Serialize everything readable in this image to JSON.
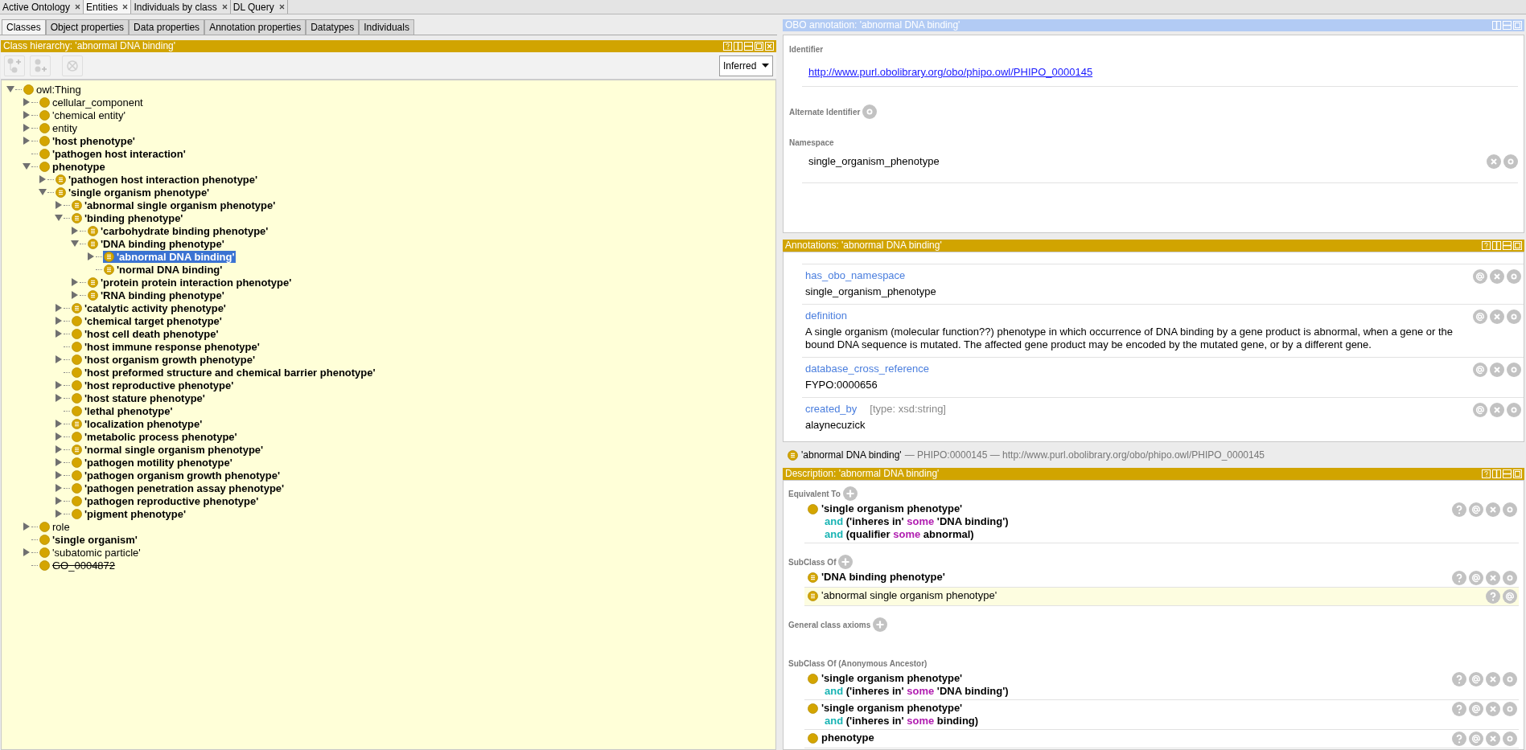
{
  "tabs": [
    {
      "label": "Active Ontology",
      "selected": false
    },
    {
      "label": "Entities",
      "selected": true
    },
    {
      "label": "Individuals by class",
      "selected": false
    },
    {
      "label": "DL Query",
      "selected": false
    }
  ],
  "entity_tabs": [
    {
      "label": "Classes",
      "selected": true
    },
    {
      "label": "Object properties",
      "selected": false
    },
    {
      "label": "Data properties",
      "selected": false
    },
    {
      "label": "Annotation properties",
      "selected": false
    },
    {
      "label": "Datatypes",
      "selected": false
    },
    {
      "label": "Individuals",
      "selected": false
    }
  ],
  "class_hierarchy": {
    "title": "Class hierarchy: 'abnormal DNA binding'",
    "mode": "Inferred",
    "tree": [
      {
        "label": "owl:Thing",
        "expanded": true,
        "bold": false,
        "defined": false,
        "selected": false,
        "deprecated": false,
        "children": [
          {
            "label": "cellular_component",
            "expanded": false,
            "bold": false,
            "defined": false,
            "selected": false,
            "deprecated": false
          },
          {
            "label": "'chemical entity'",
            "expanded": false,
            "bold": false,
            "defined": false,
            "selected": false,
            "deprecated": false
          },
          {
            "label": "entity",
            "expanded": false,
            "bold": false,
            "defined": false,
            "selected": false,
            "deprecated": false
          },
          {
            "label": "'host phenotype'",
            "expanded": false,
            "bold": true,
            "defined": false,
            "selected": false,
            "deprecated": false
          },
          {
            "label": "'pathogen host interaction'",
            "bold": true,
            "defined": false,
            "selected": false,
            "deprecated": false
          },
          {
            "label": "phenotype",
            "expanded": true,
            "bold": true,
            "defined": false,
            "selected": false,
            "deprecated": false,
            "children": [
              {
                "label": "'pathogen host interaction phenotype'",
                "expanded": false,
                "bold": true,
                "defined": true,
                "selected": false,
                "deprecated": false
              },
              {
                "label": "'single organism phenotype'",
                "expanded": true,
                "bold": true,
                "defined": true,
                "selected": false,
                "deprecated": false,
                "children": [
                  {
                    "label": "'abnormal single organism phenotype'",
                    "expanded": false,
                    "bold": true,
                    "defined": true,
                    "selected": false,
                    "deprecated": false
                  },
                  {
                    "label": "'binding phenotype'",
                    "expanded": true,
                    "bold": true,
                    "defined": true,
                    "selected": false,
                    "deprecated": false,
                    "children": [
                      {
                        "label": "'carbohydrate binding phenotype'",
                        "expanded": false,
                        "bold": true,
                        "defined": true,
                        "selected": false,
                        "deprecated": false
                      },
                      {
                        "label": "'DNA binding phenotype'",
                        "expanded": true,
                        "bold": true,
                        "defined": true,
                        "selected": false,
                        "deprecated": false,
                        "children": [
                          {
                            "label": "'abnormal DNA binding'",
                            "expanded": false,
                            "bold": true,
                            "defined": true,
                            "selected": true,
                            "deprecated": false
                          },
                          {
                            "label": "'normal DNA binding'",
                            "bold": true,
                            "defined": true,
                            "selected": false,
                            "deprecated": false
                          }
                        ]
                      },
                      {
                        "label": "'protein protein interaction phenotype'",
                        "expanded": false,
                        "bold": true,
                        "defined": true,
                        "selected": false,
                        "deprecated": false
                      },
                      {
                        "label": "'RNA binding phenotype'",
                        "expanded": false,
                        "bold": true,
                        "defined": true,
                        "selected": false,
                        "deprecated": false
                      }
                    ]
                  },
                  {
                    "label": "'catalytic activity phenotype'",
                    "expanded": false,
                    "bold": true,
                    "defined": true,
                    "selected": false,
                    "deprecated": false
                  },
                  {
                    "label": "'chemical target phenotype'",
                    "expanded": false,
                    "bold": true,
                    "defined": false,
                    "selected": false,
                    "deprecated": false
                  },
                  {
                    "label": "'host cell death phenotype'",
                    "expanded": false,
                    "bold": true,
                    "defined": false,
                    "selected": false,
                    "deprecated": false
                  },
                  {
                    "label": "'host immune response phenotype'",
                    "bold": true,
                    "defined": false,
                    "selected": false,
                    "deprecated": false
                  },
                  {
                    "label": "'host organism growth phenotype'",
                    "expanded": false,
                    "bold": true,
                    "defined": false,
                    "selected": false,
                    "deprecated": false
                  },
                  {
                    "label": "'host preformed structure and chemical barrier phenotype'",
                    "bold": true,
                    "defined": false,
                    "selected": false,
                    "deprecated": false
                  },
                  {
                    "label": "'host reproductive phenotype'",
                    "expanded": false,
                    "bold": true,
                    "defined": false,
                    "selected": false,
                    "deprecated": false
                  },
                  {
                    "label": "'host stature phenotype'",
                    "expanded": false,
                    "bold": true,
                    "defined": false,
                    "selected": false,
                    "deprecated": false
                  },
                  {
                    "label": "'lethal phenotype'",
                    "bold": true,
                    "defined": false,
                    "selected": false,
                    "deprecated": false
                  },
                  {
                    "label": "'localization phenotype'",
                    "expanded": false,
                    "bold": true,
                    "defined": true,
                    "selected": false,
                    "deprecated": false
                  },
                  {
                    "label": "'metabolic process phenotype'",
                    "expanded": false,
                    "bold": true,
                    "defined": false,
                    "selected": false,
                    "deprecated": false
                  },
                  {
                    "label": "'normal single organism phenotype'",
                    "expanded": false,
                    "bold": true,
                    "defined": true,
                    "selected": false,
                    "deprecated": false
                  },
                  {
                    "label": "'pathogen motility phenotype'",
                    "expanded": false,
                    "bold": true,
                    "defined": false,
                    "selected": false,
                    "deprecated": false
                  },
                  {
                    "label": "'pathogen organism growth phenotype'",
                    "expanded": false,
                    "bold": true,
                    "defined": false,
                    "selected": false,
                    "deprecated": false
                  },
                  {
                    "label": "'pathogen penetration assay phenotype'",
                    "expanded": false,
                    "bold": true,
                    "defined": false,
                    "selected": false,
                    "deprecated": false
                  },
                  {
                    "label": "'pathogen reproductive phenotype'",
                    "expanded": false,
                    "bold": true,
                    "defined": false,
                    "selected": false,
                    "deprecated": false
                  },
                  {
                    "label": "'pigment phenotype'",
                    "expanded": false,
                    "bold": true,
                    "defined": false,
                    "selected": false,
                    "deprecated": false
                  }
                ]
              }
            ]
          },
          {
            "label": "role",
            "expanded": false,
            "bold": false,
            "defined": false,
            "selected": false,
            "deprecated": false
          },
          {
            "label": "'single organism'",
            "bold": true,
            "defined": false,
            "selected": false,
            "deprecated": false
          },
          {
            "label": "'subatomic particle'",
            "expanded": false,
            "bold": false,
            "defined": false,
            "selected": false,
            "deprecated": false
          },
          {
            "label": "GO_0004872",
            "bold": false,
            "defined": false,
            "selected": false,
            "deprecated": true
          }
        ]
      }
    ]
  },
  "obo_annotation": {
    "title": "OBO annotation: 'abnormal DNA binding'",
    "identifier_label": "Identifier",
    "identifier": "http://www.purl.obolibrary.org/obo/phipo.owl/PHIPO_0000145",
    "alternate_label": "Alternate Identifier",
    "namespace_label": "Namespace",
    "namespace": "single_organism_phenotype"
  },
  "annotations": {
    "title": "Annotations: 'abnormal DNA binding'",
    "rows": [
      {
        "property": "has_obo_namespace",
        "value": "single_organism_phenotype"
      },
      {
        "property": "definition",
        "value": "A single organism (molecular function??) phenotype in which occurrence of DNA binding by a gene product is abnormal, when a gene or the bound DNA sequence is mutated. The affected gene product may be encoded by the mutated gene, or by a different gene."
      },
      {
        "property": "database_cross_reference",
        "value": "FYPO:0000656"
      },
      {
        "property": "created_by",
        "type": "[type: xsd:string]",
        "value": "alaynecuzick"
      }
    ]
  },
  "entity_status": {
    "defined": true,
    "name": "'abnormal DNA binding'",
    "details": "— PHIPO:0000145 — http://www.purl.obolibrary.org/obo/phipo.owl/PHIPO_0000145"
  },
  "description": {
    "title": "Description: 'abnormal DNA binding'",
    "sections": [
      {
        "label": "Equivalent To",
        "addable": true,
        "entries": [
          {
            "defined": false,
            "inherited": false,
            "lines": [
              [
                {
                  "text": "'single organism phenotype'",
                  "kind": "plain"
                }
              ],
              [
                {
                  "text": "and",
                  "kind": "keyword"
                },
                {
                  "text": " ('inheres in' ",
                  "kind": "plain"
                },
                {
                  "text": "some",
                  "kind": "quantifier"
                },
                {
                  "text": " 'DNA binding')",
                  "kind": "plain"
                }
              ],
              [
                {
                  "text": "and",
                  "kind": "keyword"
                },
                {
                  "text": " (qualifier ",
                  "kind": "plain"
                },
                {
                  "text": "some",
                  "kind": "quantifier"
                },
                {
                  "text": " abnormal)",
                  "kind": "plain"
                }
              ]
            ]
          }
        ]
      },
      {
        "label": "SubClass Of",
        "addable": true,
        "entries": [
          {
            "defined": true,
            "inherited": false,
            "lines": [
              [
                {
                  "text": "'DNA binding phenotype'",
                  "kind": "plain"
                }
              ]
            ]
          },
          {
            "defined": true,
            "inherited": true,
            "lines": [
              [
                {
                  "text": "'abnormal single organism phenotype'",
                  "kind": "plain"
                }
              ]
            ]
          }
        ]
      },
      {
        "label": "General class axioms",
        "addable": true
      },
      {
        "label": "SubClass Of (Anonymous Ancestor)",
        "addable": false,
        "entries": [
          {
            "defined": false,
            "inherited": false,
            "lines": [
              [
                {
                  "text": "'single organism phenotype'",
                  "kind": "plain"
                }
              ],
              [
                {
                  "text": "and",
                  "kind": "keyword"
                },
                {
                  "text": " ('inheres in' ",
                  "kind": "plain"
                },
                {
                  "text": "some",
                  "kind": "quantifier"
                },
                {
                  "text": " 'DNA binding')",
                  "kind": "plain"
                }
              ]
            ]
          },
          {
            "defined": false,
            "inherited": false,
            "lines": [
              [
                {
                  "text": "'single organism phenotype'",
                  "kind": "plain"
                }
              ],
              [
                {
                  "text": "and",
                  "kind": "keyword"
                },
                {
                  "text": " ('inheres in' ",
                  "kind": "plain"
                },
                {
                  "text": "some",
                  "kind": "quantifier"
                },
                {
                  "text": " binding)",
                  "kind": "plain"
                }
              ]
            ]
          },
          {
            "defined": false,
            "inherited": false,
            "lines": [
              [
                {
                  "text": "phenotype",
                  "kind": "plain"
                }
              ]
            ]
          }
        ]
      }
    ]
  }
}
